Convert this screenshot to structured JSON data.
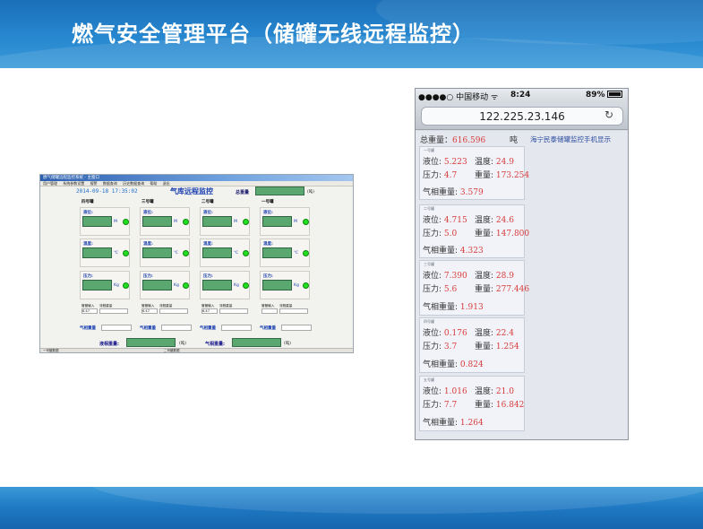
{
  "slide": {
    "title": "燃气安全管理平台（储罐无线远程监控）"
  },
  "desktop": {
    "window_title": "燃气储罐远程监控系统 - 主窗口",
    "menu": [
      "用户管理",
      "系统参数设置",
      "报警",
      "数据查询",
      "历史数据查询",
      "帮助",
      "退出"
    ],
    "timestamp": "2014-09-18 17:35:02",
    "app_title": "气库远程监控",
    "total_label": "总重量",
    "total_unit": "(吨)",
    "tanks": [
      {
        "name": "四号罐",
        "liquid_label": "液位:",
        "liquid_unit": "M",
        "temp_label": "温度:",
        "temp_unit": "℃",
        "pressure_label": "压力:",
        "pressure_unit": "Kg",
        "in1_label": "管管输入",
        "in2_label": "流程重量",
        "in1_value": "6.47",
        "in2_value": "",
        "gas_label": "气相重量"
      },
      {
        "name": "三号罐",
        "liquid_label": "液位:",
        "liquid_unit": "M",
        "temp_label": "温度:",
        "temp_unit": "℃",
        "pressure_label": "压力:",
        "pressure_unit": "Kg",
        "in1_label": "管管输入",
        "in2_label": "流程重量",
        "in1_value": "6.47",
        "in2_value": "",
        "gas_label": "气相重量"
      },
      {
        "name": "二号罐",
        "liquid_label": "液位:",
        "liquid_unit": "M",
        "temp_label": "温度:",
        "temp_unit": "℃",
        "pressure_label": "压力:",
        "pressure_unit": "Kg",
        "in1_label": "管管输入",
        "in2_label": "流程重量",
        "in1_value": "6.47",
        "in2_value": "",
        "gas_label": "气相重量"
      },
      {
        "name": "一号罐",
        "liquid_label": "液位:",
        "liquid_unit": "M",
        "temp_label": "温度:",
        "temp_unit": "℃",
        "pressure_label": "压力:",
        "pressure_unit": "Kg",
        "in1_label": "管管输入",
        "in2_label": "流程重量",
        "in1_value": "",
        "in2_value": "",
        "gas_label": "气相重量"
      }
    ],
    "bottom_liquid_label": "液相重量:",
    "bottom_gas_label": "气相重量:",
    "bottom_unit": "(吨)",
    "status_left": "一号罐数据",
    "status_mid": "二号罐数据"
  },
  "phone": {
    "carrier": "●●●●○ 中国移动 ᯤ",
    "time": "8:24",
    "battery": "89%",
    "url": "122.225.23.146",
    "reload_icon": "↻",
    "total_label": "总重量：",
    "total_value": "616.596",
    "total_unit": "吨",
    "link_text": "海宁民泰储罐监控手机显示",
    "cards": [
      {
        "caption": "一号罐",
        "liquid_label": "液位:",
        "liquid": "5.223",
        "temp_label": "温度:",
        "temp": "24.9",
        "pressure_label": "压力:",
        "pressure": "4.7",
        "weight_label": "重量:",
        "weight": "173.254",
        "gas_label": "气相重量:",
        "gas": "3.579"
      },
      {
        "caption": "二号罐",
        "liquid_label": "液位:",
        "liquid": "4.715",
        "temp_label": "温度:",
        "temp": "24.6",
        "pressure_label": "压力:",
        "pressure": "5.0",
        "weight_label": "重量:",
        "weight": "147.800",
        "gas_label": "气相重量:",
        "gas": "4.323"
      },
      {
        "caption": "三号罐",
        "liquid_label": "液位:",
        "liquid": "7.390",
        "temp_label": "温度:",
        "temp": "28.9",
        "pressure_label": "压力:",
        "pressure": "5.6",
        "weight_label": "重量:",
        "weight": "277.446",
        "gas_label": "气相重量:",
        "gas": "1.913"
      },
      {
        "caption": "四号罐",
        "liquid_label": "液位:",
        "liquid": "0.176",
        "temp_label": "温度:",
        "temp": "22.4",
        "pressure_label": "压力:",
        "pressure": "3.7",
        "weight_label": "重量:",
        "weight": "1.254",
        "gas_label": "气相重量:",
        "gas": "0.824"
      },
      {
        "caption": "五号罐",
        "liquid_label": "液位:",
        "liquid": "1.016",
        "temp_label": "温度:",
        "temp": "21.0",
        "pressure_label": "压力:",
        "pressure": "7.7",
        "weight_label": "重量:",
        "weight": "16.842",
        "gas_label": "气相重量:",
        "gas": "1.264"
      }
    ]
  }
}
